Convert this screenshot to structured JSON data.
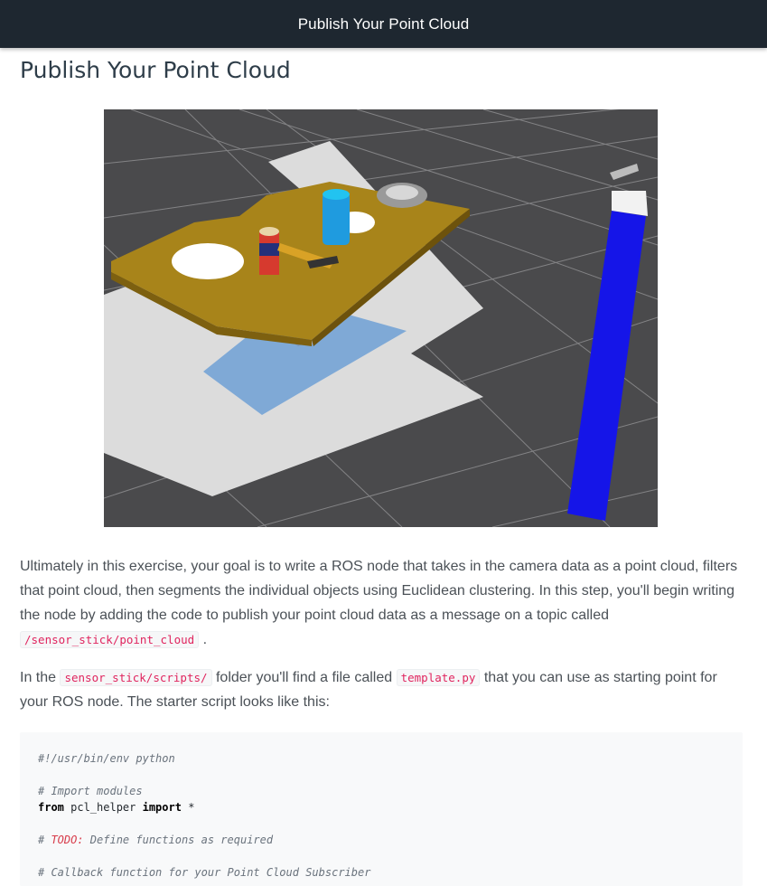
{
  "header": {
    "title": "Publish Your Point Cloud"
  },
  "page": {
    "heading": "Publish Your Point Cloud"
  },
  "figure": {
    "name": "Gazebo scene with table, objects and sensor stick"
  },
  "paragraph1": {
    "text": "Ultimately in this exercise, your goal is to write a ROS node that takes in the camera data as a point cloud, filters that point cloud, then segments the individual objects using Euclidean clustering. In this step, you'll begin writing the node by adding the code to publish your point cloud data as a message on a topic called ",
    "code": "/sensor_stick/point_cloud",
    "end": "."
  },
  "paragraph2": {
    "part1": "In the ",
    "code1": "sensor_stick/scripts/",
    "part2": " folder you'll find a file called ",
    "code2": "template.py",
    "part3": " that you can use as starting point for your ROS node. The starter script looks like this:"
  },
  "code": {
    "line1": "#!/usr/bin/env python",
    "line3": "# Import modules",
    "line4_kw1": "from",
    "line4_mod": " pcl_helper ",
    "line4_kw2": "import",
    "line4_rest": " *",
    "line6_hash": "# ",
    "line6_todo": "TODO:",
    "line6_rest": " Define functions as required",
    "line8": "# Callback function for your Point Cloud Subscriber"
  },
  "colors": {
    "topbar": "#1e2730",
    "inline_code": "#e0245e",
    "scene_floor": "#4a4a4c",
    "table_top": "#a8841a",
    "stick_blue": "#1515e8"
  }
}
